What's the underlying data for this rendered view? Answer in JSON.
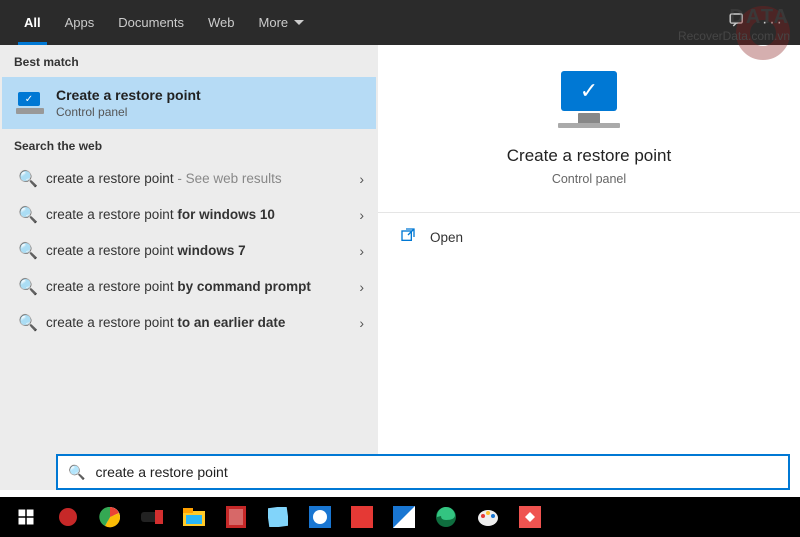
{
  "topbar": {
    "tabs": [
      "All",
      "Apps",
      "Documents",
      "Web",
      "More"
    ]
  },
  "left": {
    "best_match_label": "Best match",
    "best_match": {
      "title": "Create a restore point",
      "subtitle": "Control panel"
    },
    "web_label": "Search the web",
    "web_items": [
      {
        "base": "create a restore point",
        "suffix_gray": " - See web results",
        "suffix_bold": ""
      },
      {
        "base": "create a restore point ",
        "suffix_gray": "",
        "suffix_bold": "for windows 10"
      },
      {
        "base": "create a restore point ",
        "suffix_gray": "",
        "suffix_bold": "windows 7"
      },
      {
        "base": "create a restore point ",
        "suffix_gray": "",
        "suffix_bold": "by command prompt"
      },
      {
        "base": "create a restore point ",
        "suffix_gray": "",
        "suffix_bold": "to an earlier date"
      }
    ]
  },
  "right": {
    "title": "Create a restore point",
    "subtitle": "Control panel",
    "open_label": "Open"
  },
  "search": {
    "query": "create a restore point"
  },
  "watermark": {
    "line1": "DATA",
    "line2": "RecoverData.com.vn"
  }
}
